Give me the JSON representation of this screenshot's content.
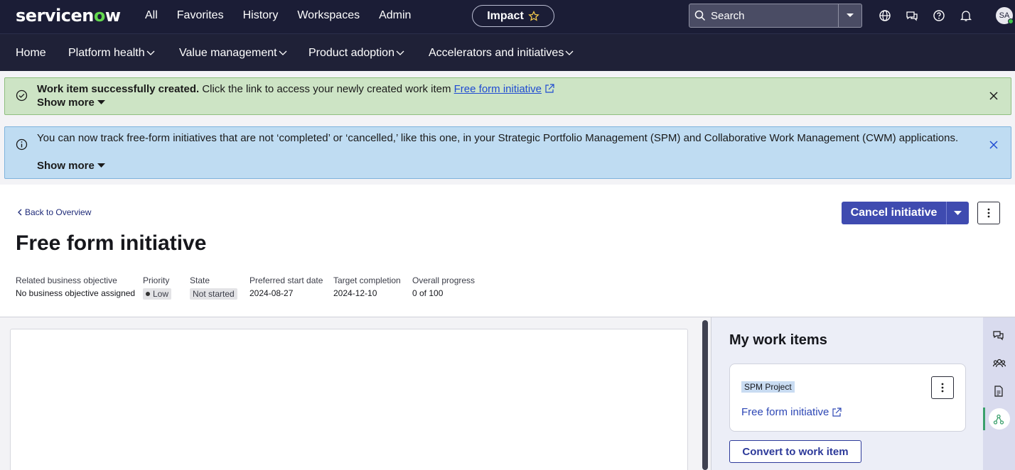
{
  "topbar": {
    "logo_a": "servicen",
    "logo_o": "o",
    "logo_b": "w",
    "nav": [
      "All",
      "Favorites",
      "History",
      "Workspaces",
      "Admin"
    ],
    "impact_label": "Impact",
    "search_placeholder": "Search",
    "avatar_initials": "SA"
  },
  "subnav": {
    "items": [
      "Home",
      "Platform health",
      "Value management",
      "Product adoption",
      "Accelerators and initiatives"
    ]
  },
  "banners": {
    "success": {
      "title": "Work item successfully created.",
      "message": " Click the link to access your newly created work item ",
      "link": "Free form initiative",
      "show_more": "Show more"
    },
    "info": {
      "message": "You can now track free-form initiatives that are not ‘completed’ or ‘cancelled,’ like this one, in your Strategic Portfolio Management (SPM) and Collaborative Work Management (CWM) applications.",
      "show_more": "Show more"
    }
  },
  "header": {
    "back_label": "Back to Overview",
    "title": "Free form initiative",
    "cancel_label": "Cancel initiative",
    "meta": {
      "objective_label": "Related business objective",
      "objective_value": "No business objective assigned",
      "priority_label": "Priority",
      "priority_value": "Low",
      "state_label": "State",
      "state_value": "Not started",
      "start_label": "Preferred start date",
      "start_value": "2024-08-27",
      "target_label": "Target completion",
      "target_value": "2024-12-10",
      "progress_label": "Overall progress",
      "progress_value": "0 of 100"
    }
  },
  "right_panel": {
    "title": "My work items",
    "card_tag": "SPM Project",
    "card_link": "Free form initiative",
    "convert_label": "Convert to work item"
  }
}
